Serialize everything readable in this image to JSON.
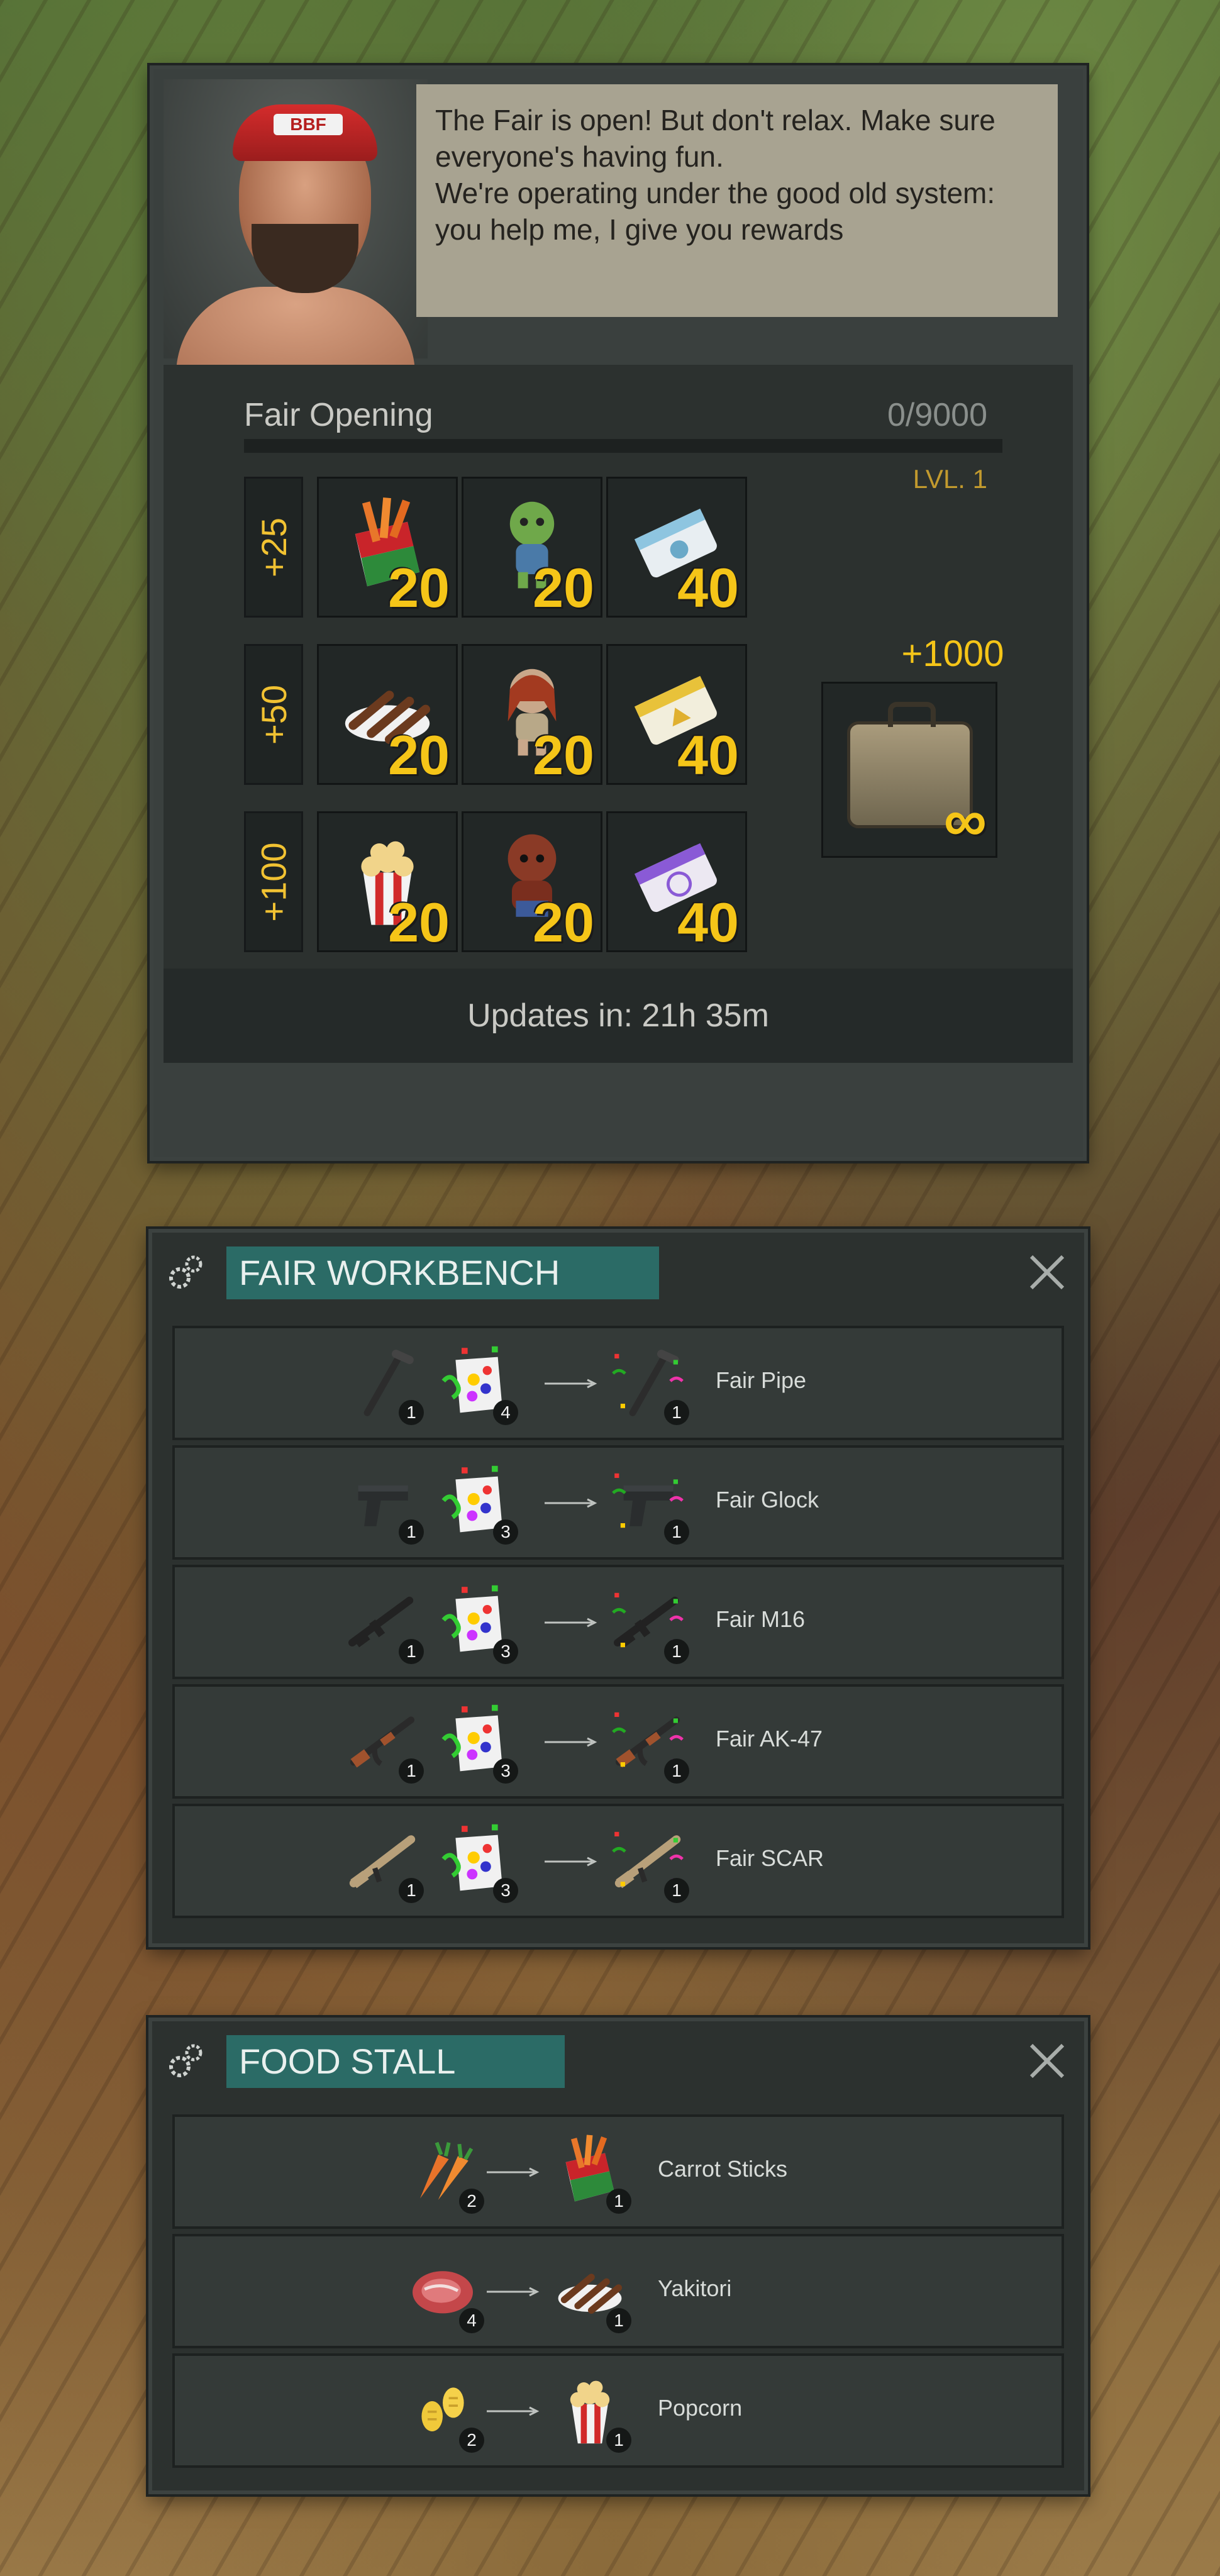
{
  "fair": {
    "speech_line1": "The Fair is open! But don't relax. Make sure everyone's having fun.",
    "speech_line2": "We're operating under the good old system: you help me, I give you rewards",
    "cap_text": "BBF",
    "progress_title": "Fair Opening",
    "progress_count": "0/9000",
    "progress_fraction": 0,
    "level": "LVL. 1",
    "tiers": [
      {
        "label": "+25",
        "items": [
          {
            "icon": "carrot-sticks-icon",
            "qty": "20"
          },
          {
            "icon": "green-zombie-doll-icon",
            "qty": "20"
          },
          {
            "icon": "blue-ticket-icon",
            "qty": "40"
          }
        ]
      },
      {
        "label": "+50",
        "items": [
          {
            "icon": "yakitori-icon",
            "qty": "20"
          },
          {
            "icon": "red-hair-zombie-doll-icon",
            "qty": "20"
          },
          {
            "icon": "yellow-ticket-icon",
            "qty": "40"
          }
        ]
      },
      {
        "label": "+100",
        "items": [
          {
            "icon": "popcorn-icon",
            "qty": "20"
          },
          {
            "icon": "brown-zombie-doll-icon",
            "qty": "20"
          },
          {
            "icon": "purple-ticket-icon",
            "qty": "40"
          }
        ]
      }
    ],
    "big_reward_label": "+1000",
    "big_reward_qty": "∞",
    "updates": "Updates in: 21h 35m"
  },
  "workbench": {
    "title": "FAIR WORKBENCH",
    "recipes": [
      {
        "in1_icon": "pipe-icon",
        "in1_qty": "1",
        "in2_icon": "confetti-bag-icon",
        "in2_qty": "4",
        "out_icon": "fair-pipe-icon",
        "out_qty": "1",
        "name": "Fair Pipe"
      },
      {
        "in1_icon": "glock-icon",
        "in1_qty": "1",
        "in2_icon": "confetti-bag-icon",
        "in2_qty": "3",
        "out_icon": "fair-glock-icon",
        "out_qty": "1",
        "name": "Fair Glock"
      },
      {
        "in1_icon": "m16-icon",
        "in1_qty": "1",
        "in2_icon": "confetti-bag-icon",
        "in2_qty": "3",
        "out_icon": "fair-m16-icon",
        "out_qty": "1",
        "name": "Fair M16"
      },
      {
        "in1_icon": "ak47-icon",
        "in1_qty": "1",
        "in2_icon": "confetti-bag-icon",
        "in2_qty": "3",
        "out_icon": "fair-ak47-icon",
        "out_qty": "1",
        "name": "Fair AK-47"
      },
      {
        "in1_icon": "scar-icon",
        "in1_qty": "1",
        "in2_icon": "confetti-bag-icon",
        "in2_qty": "3",
        "out_icon": "fair-scar-icon",
        "out_qty": "1",
        "name": "Fair SCAR"
      }
    ]
  },
  "food_stall": {
    "title": "FOOD STALL",
    "recipes": [
      {
        "in_icon": "carrots-icon",
        "in_qty": "2",
        "out_icon": "carrot-sticks-icon",
        "out_qty": "1",
        "name": "Carrot Sticks"
      },
      {
        "in_icon": "raw-meat-icon",
        "in_qty": "4",
        "out_icon": "yakitori-icon",
        "out_qty": "1",
        "name": "Yakitori"
      },
      {
        "in_icon": "corn-icon",
        "in_qty": "2",
        "out_icon": "popcorn-icon",
        "out_qty": "1",
        "name": "Popcorn"
      }
    ]
  },
  "colors": {
    "accent_yellow": "#f5c518",
    "title_teal": "#2b6b66",
    "panel": "#2c312f"
  }
}
